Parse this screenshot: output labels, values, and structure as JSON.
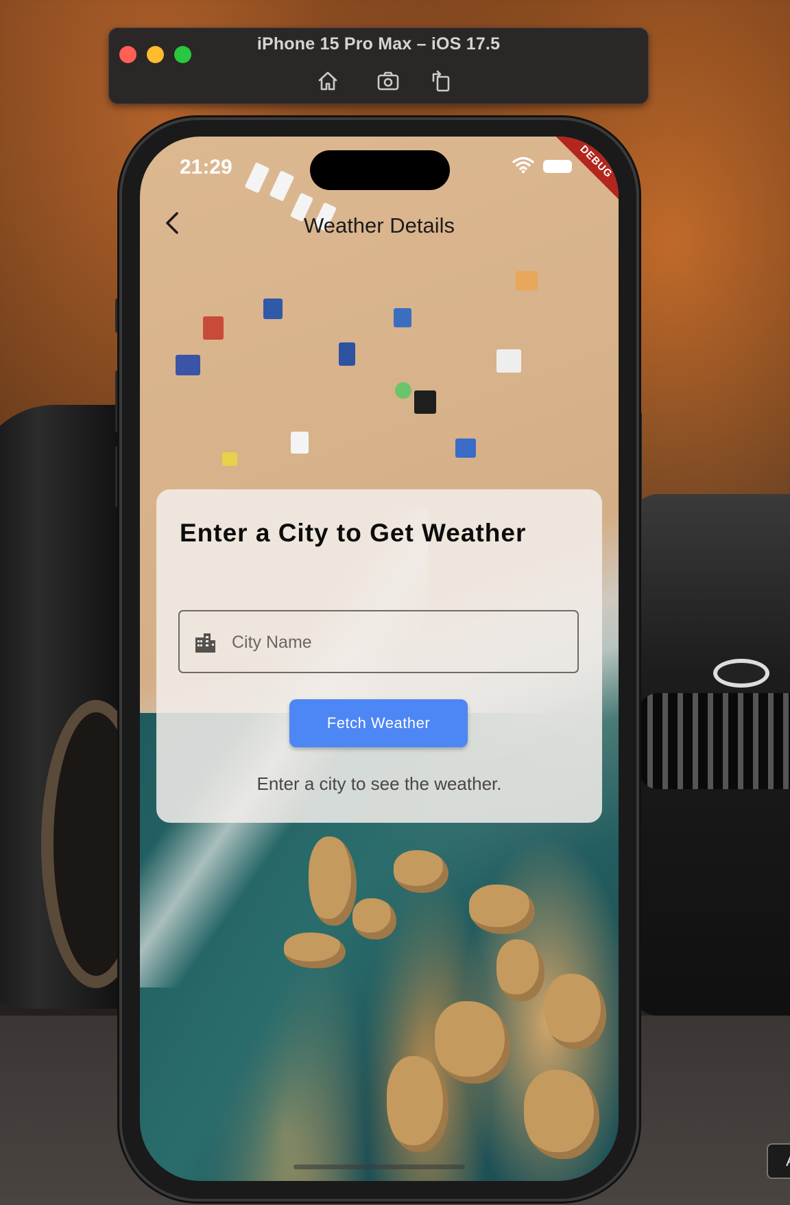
{
  "simulator": {
    "title": "iPhone 15 Pro Max – iOS 17.5",
    "tools": [
      "home-icon",
      "screenshot-icon",
      "rotate-icon"
    ]
  },
  "status_bar": {
    "time": "21:29",
    "debug_label": "DEBUG"
  },
  "nav": {
    "title": "Weather Details"
  },
  "card": {
    "heading": "Enter a City to Get Weather",
    "city_placeholder": "City Name",
    "fetch_label": "Fetch Weather",
    "hint": "Enter a city to see the weather."
  },
  "colors": {
    "accent": "#4d86f5",
    "debug_banner": "#b3261e"
  },
  "background": {
    "corner_label": "A"
  }
}
